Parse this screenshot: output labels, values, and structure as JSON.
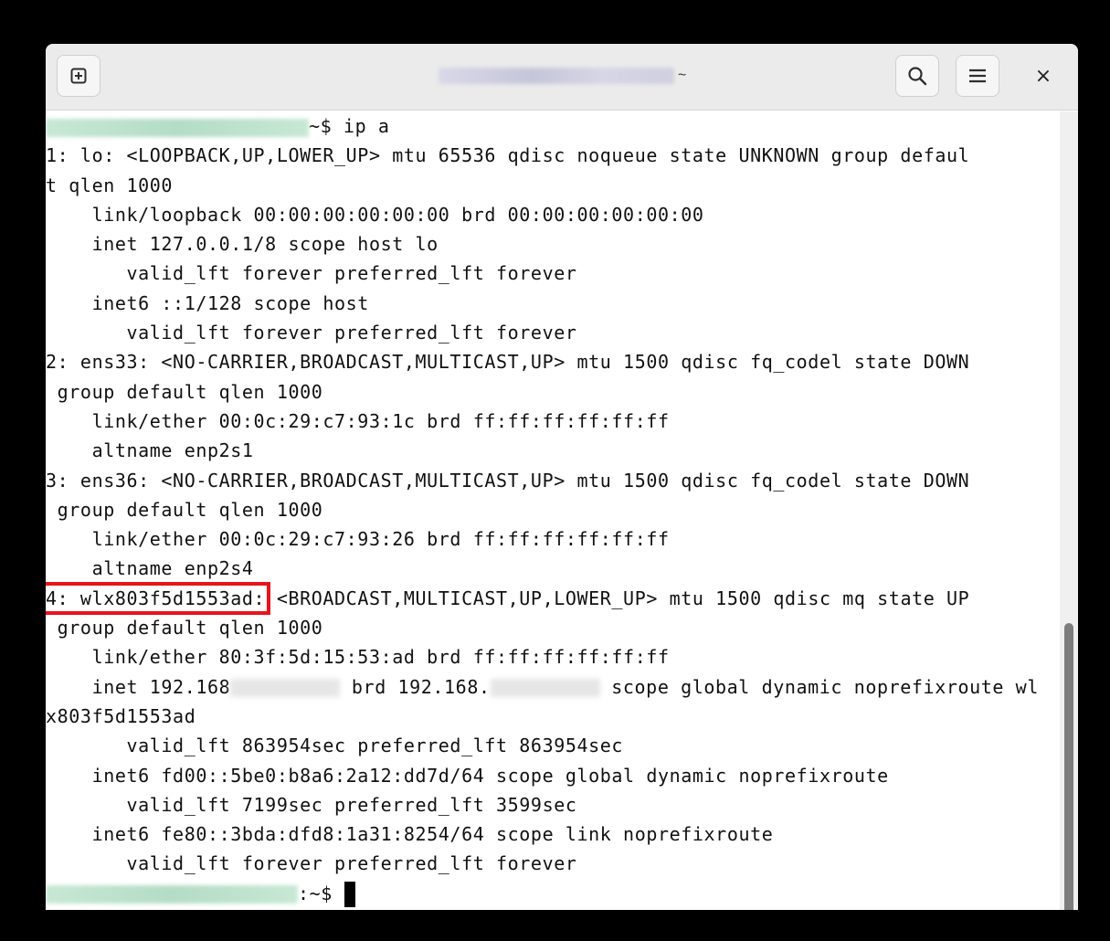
{
  "header": {
    "new_tab_icon": "plus-square-icon",
    "title_suffix": "~",
    "search_icon": "search-icon",
    "menu_icon": "hamburger-menu-icon",
    "close_label": "×"
  },
  "terminal": {
    "prompt_suffix_1": "~$ ",
    "command": "ip a",
    "lines": [
      "1: lo: <LOOPBACK,UP,LOWER_UP> mtu 65536 qdisc noqueue state UNKNOWN group defaul",
      "t qlen 1000",
      "    link/loopback 00:00:00:00:00:00 brd 00:00:00:00:00:00",
      "    inet 127.0.0.1/8 scope host lo",
      "       valid_lft forever preferred_lft forever",
      "    inet6 ::1/128 scope host",
      "       valid_lft forever preferred_lft forever",
      "2: ens33: <NO-CARRIER,BROADCAST,MULTICAST,UP> mtu 1500 qdisc fq_codel state DOWN",
      " group default qlen 1000",
      "    link/ether 00:0c:29:c7:93:1c brd ff:ff:ff:ff:ff:ff",
      "    altname enp2s1",
      "3: ens36: <NO-CARRIER,BROADCAST,MULTICAST,UP> mtu 1500 qdisc fq_codel state DOWN",
      " group default qlen 1000",
      "    link/ether 00:0c:29:c7:93:26 brd ff:ff:ff:ff:ff:ff",
      "    altname enp2s4"
    ],
    "iface4_name": "4: wlx803f5d1553ad:",
    "iface4_rest": " <BROADCAST,MULTICAST,UP,LOWER_UP> mtu 1500 qdisc mq state UP",
    "lines_after": [
      " group default qlen 1000",
      "    link/ether 80:3f:5d:15:53:ad brd ff:ff:ff:ff:ff:ff"
    ],
    "inet_prefix": "    inet 192.168",
    "inet_mid": " brd 192.168.",
    "inet_suffix": " scope global dynamic noprefixroute wl",
    "lines_end": [
      "x803f5d1553ad",
      "       valid_lft 863954sec preferred_lft 863954sec",
      "    inet6 fd00::5be0:b8a6:2a12:dd7d/64 scope global dynamic noprefixroute",
      "       valid_lft 7199sec preferred_lft 3599sec",
      "    inet6 fe80::3bda:dfd8:1a31:8254/64 scope link noprefixroute",
      "       valid_lft forever preferred_lft forever"
    ],
    "prompt_suffix_2": ":~$ "
  }
}
